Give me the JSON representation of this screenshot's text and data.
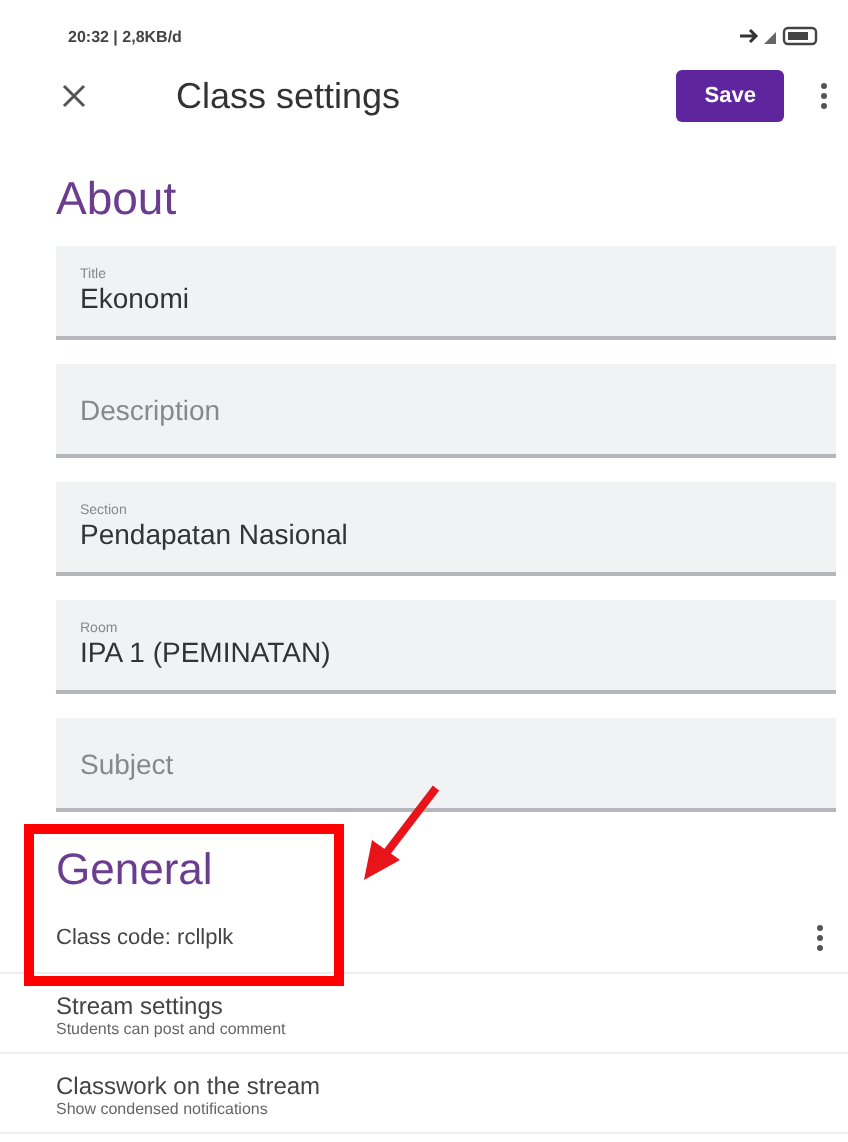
{
  "status_bar": {
    "time": "20:32 | 2,8KB/d"
  },
  "toolbar": {
    "title": "Class settings",
    "save": "Save"
  },
  "about": {
    "heading": "About",
    "fields": [
      {
        "label": "Title",
        "value": "Ekonomi"
      },
      {
        "placeholder": "Description"
      },
      {
        "label": "Section",
        "value": "Pendapatan Nasional"
      },
      {
        "label": "Room",
        "value": "IPA 1 (PEMINATAN)"
      },
      {
        "placeholder": "Subject"
      }
    ]
  },
  "general": {
    "heading": "General",
    "class_code": "Class code: rcllplk",
    "rows": [
      {
        "title": "Stream settings",
        "subtitle": "Students can post and comment"
      },
      {
        "title": "Classwork on the stream",
        "subtitle": "Show condensed notifications"
      }
    ]
  }
}
